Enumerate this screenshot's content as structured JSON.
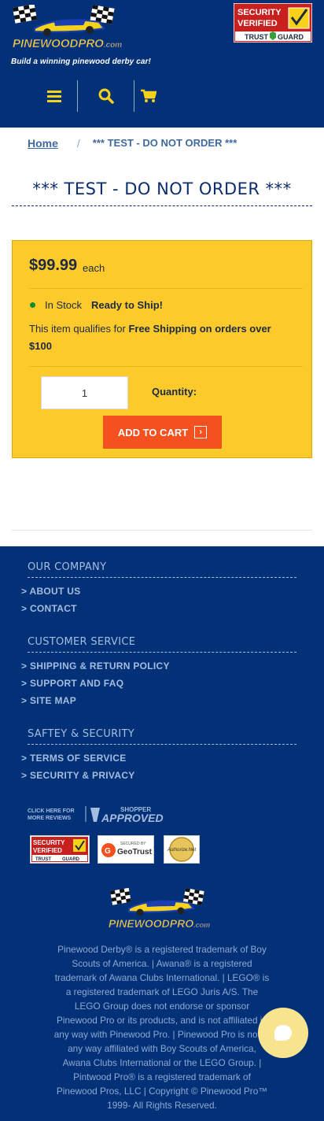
{
  "header": {
    "logo_text": "PINEWOODPRO.com",
    "tagline": "Build a winning pinewood derby car!",
    "security_seal": {
      "line1": "SECURITY",
      "line2": "VERIFIED",
      "line3": "TRUST",
      "line4": "GUARD"
    }
  },
  "nav": {
    "menu_icon": "menu-icon",
    "search_icon": "search-icon",
    "cart_icon": "cart-icon"
  },
  "breadcrumb": {
    "home": "Home",
    "separator": "/",
    "current": "*** TEST - DO NOT ORDER ***"
  },
  "product": {
    "title": "*** TEST - DO NOT ORDER ***",
    "price": "$99.99",
    "price_unit": "each",
    "stock_status": "In Stock",
    "ready_label": "Ready to Ship!",
    "shipping_prefix": "This item qualifies for ",
    "shipping_bold": "Free Shipping on orders over $100",
    "quantity_value": "1",
    "quantity_label": "Quantity:",
    "add_to_cart": "ADD TO CART"
  },
  "footer": {
    "company_heading": "OUR COMPANY",
    "company_links": [
      "> ABOUT US",
      "> CONTACT"
    ],
    "service_heading": "CUSTOMER SERVICE",
    "service_links": [
      "> SHIPPING & RETURN POLICY",
      "> SUPPORT AND FAQ",
      "> SITE MAP"
    ],
    "security_heading": "SAFTEY & SECURITY",
    "security_links": [
      "> TERMS OF SERVICE",
      "> SECURITY & PRIVACY"
    ],
    "shopper_click": "CLICK HERE FOR MORE REVIEWS",
    "shopper_brand": "SHOPPER APPROVED",
    "badge_trustguard": "SECURITY VERIFIED TRUST GUARD",
    "badge_geotrust": "SECURED BY GeoTrust",
    "badge_authorize": "Authorize.Net",
    "logo_text": "PINEWOODPRO.com",
    "legal": "Pinewood Derby® is a registered trademark of Boy Scouts of America. | Awana® is a registered trademark of Awana Clubs International. | LEGO® is a registered trademark of LEGO Juris A/S. The LEGO Group does not endorse or sponsor Pinewood Pro or its products, and is not affiliated in any way with Pinewood Pro. | Pinewood Pro is not in any way affiliated with Boy Scouts of America, Awana Clubs International or the LEGO Group. | Pintwood Pro® is a registered trademark of Pinewood Pros, LLC | Copyright © Pinewood Pro™ 1999- All Rights Reserved."
  },
  "chat": {
    "icon": "chat-icon"
  },
  "colors": {
    "navy": "#033177",
    "yellow_box": "#fdca2c",
    "cta_orange": "#f4511e",
    "footer_text": "#a4bde0",
    "stock_green": "#148a2e"
  }
}
